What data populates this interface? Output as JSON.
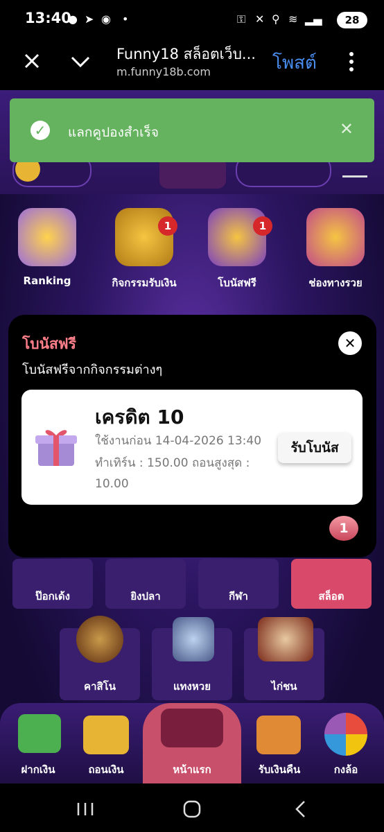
{
  "status_bar": {
    "time": "13:40",
    "battery": "28"
  },
  "browser": {
    "close_icon": "close-icon",
    "title": "Funny18 สล็อตเว็บ...",
    "url": "m.funny18b.com",
    "action": "โพสต์"
  },
  "toast": {
    "message": "แลกคูปองสำเร็จ"
  },
  "menu": [
    {
      "label": "Ranking"
    },
    {
      "label": "กิจกรรมรับเงิน",
      "badge": "1"
    },
    {
      "label": "โบนัสฟรี",
      "badge": "1"
    },
    {
      "label": "ช่องทางรวย"
    }
  ],
  "modal": {
    "title": "โบนัสฟรี",
    "subtitle": "โบนัสฟรีจากกิจกรรมต่างๆ",
    "card": {
      "credit": "เครดิต 10",
      "expiry": "ใช้งานก่อน 14-04-2026 13:40",
      "turnover": "ทำเทิร์น : 150.00  ถอนสูงสุด :",
      "max_withdraw": "10.00",
      "claim": "รับโบนัส"
    },
    "page_badge": "1"
  },
  "categories_row1": [
    {
      "label": "ป๊อกเด้ง"
    },
    {
      "label": "ยิงปลา"
    },
    {
      "label": "กีฬา"
    },
    {
      "label": "สล็อต"
    }
  ],
  "categories_row2": [
    {
      "label": "คาสิโน"
    },
    {
      "label": "แทงหวย"
    },
    {
      "label": "ไก่ชน"
    }
  ],
  "bottom_nav": [
    {
      "label": "ฝากเงิน"
    },
    {
      "label": "ถอนเงิน"
    },
    {
      "label": "หน้าแรก"
    },
    {
      "label": "รับเงินคืน"
    },
    {
      "label": "กงล้อ"
    }
  ]
}
